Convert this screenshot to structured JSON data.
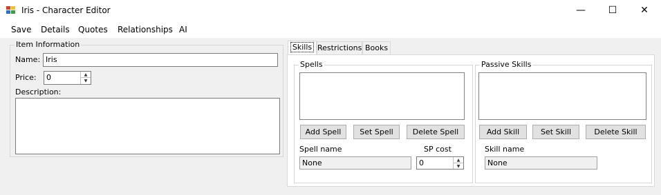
{
  "window": {
    "title": "Iris - Character Editor",
    "minimize": "—",
    "maximize": "☐",
    "close": "✕"
  },
  "menu": [
    "Save",
    "Details",
    "Quotes",
    "Relationships",
    "AI"
  ],
  "item_info": {
    "legend": "Item Information",
    "name_label": "Name:",
    "name_value": "Iris",
    "price_label": "Price:",
    "price_value": "0",
    "description_label": "Description:",
    "description_value": ""
  },
  "tabs": [
    "Skills",
    "Restrictions",
    "Books"
  ],
  "spells": {
    "legend": "Spells",
    "add": "Add Spell",
    "set": "Set Spell",
    "delete": "Delete Spell",
    "name_label": "Spell name",
    "name_value": "None",
    "cost_label": "SP cost",
    "cost_value": "0"
  },
  "passive": {
    "legend": "Passive Skills",
    "add": "Add Skill",
    "set": "Set Skill",
    "delete": "Delete Skill",
    "name_label": "Skill name",
    "name_value": "None"
  },
  "icons": {
    "spin_up": "▲",
    "spin_down": "▼"
  }
}
